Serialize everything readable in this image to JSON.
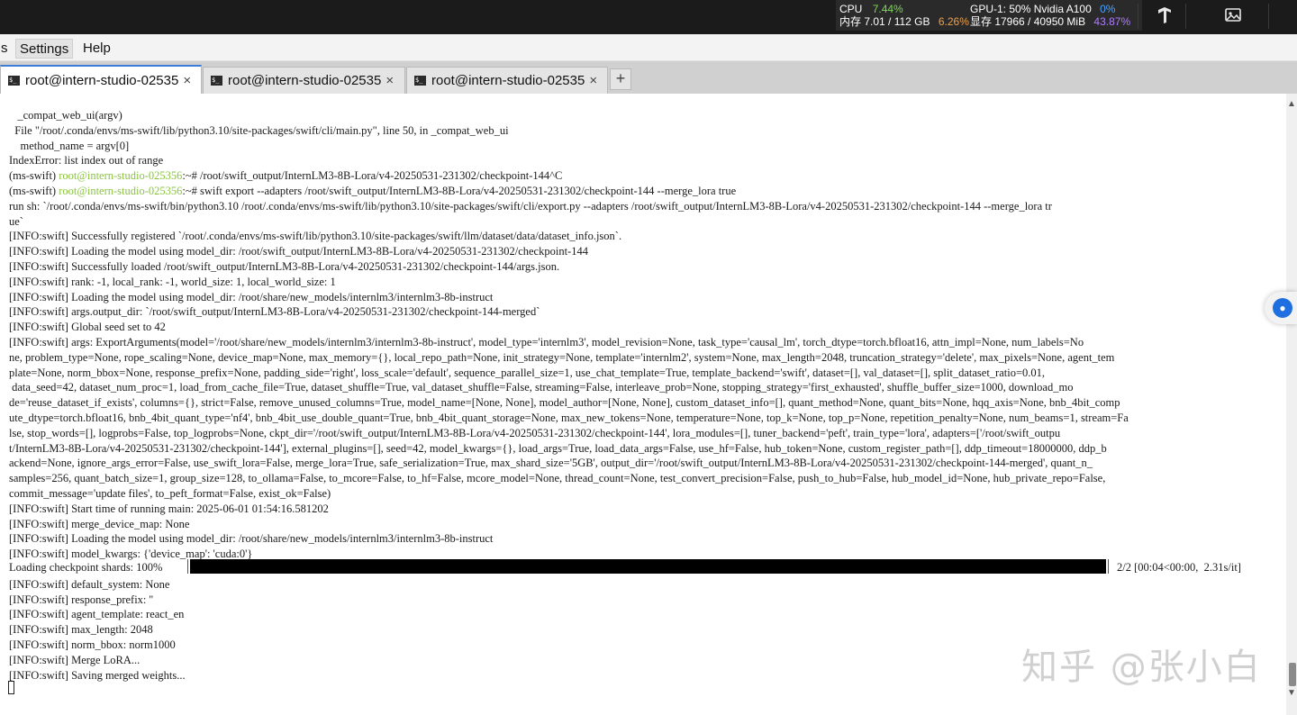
{
  "system_bar": {
    "cpu_label": "CPU",
    "cpu_value": "7.44%",
    "mem_label": "内存 7.01 / 112 GB",
    "mem_value": "6.26%",
    "gpu_label": "GPU-1: 50% Nvidia A100",
    "gpu_value": "0%",
    "vram_label": "显存 17966 / 40950 MiB",
    "vram_value": "43.87%",
    "icons": [
      "tensorflow-logo-icon",
      "image-icon"
    ]
  },
  "menu": {
    "items": [
      {
        "label": "s"
      },
      {
        "label": "Settings"
      },
      {
        "label": "Help"
      }
    ]
  },
  "tabs": [
    {
      "label": "root@intern-studio-02535",
      "close": "×"
    },
    {
      "label": "root@intern-studio-02535",
      "close": "×"
    },
    {
      "label": "root@intern-studio-02535",
      "close": "×"
    }
  ],
  "tab_add": "+",
  "terminal": {
    "lines": [
      "   _compat_web_ui(argv)",
      "  File \"/root/.conda/envs/ms-swift/lib/python3.10/site-packages/swift/cli/main.py\", line 50, in _compat_web_ui",
      "    method_name = argv[0]",
      "IndexError: list index out of range",
      "",
      "",
      "run sh: `/root/.conda/envs/ms-swift/bin/python3.10 /root/.conda/envs/ms-swift/lib/python3.10/site-packages/swift/cli/export.py --adapters /root/swift_output/InternLM3-8B-Lora/v4-20250531-231302/checkpoint-144 --merge_lora tr",
      "ue`",
      "[INFO:swift] Successfully registered `/root/.conda/envs/ms-swift/lib/python3.10/site-packages/swift/llm/dataset/data/dataset_info.json`.",
      "[INFO:swift] Loading the model using model_dir: /root/swift_output/InternLM3-8B-Lora/v4-20250531-231302/checkpoint-144",
      "[INFO:swift] Successfully loaded /root/swift_output/InternLM3-8B-Lora/v4-20250531-231302/checkpoint-144/args.json.",
      "[INFO:swift] rank: -1, local_rank: -1, world_size: 1, local_world_size: 1",
      "[INFO:swift] Loading the model using model_dir: /root/share/new_models/internlm3/internlm3-8b-instruct",
      "[INFO:swift] args.output_dir: `/root/swift_output/InternLM3-8B-Lora/v4-20250531-231302/checkpoint-144-merged`",
      "[INFO:swift] Global seed set to 42",
      "[INFO:swift] args: ExportArguments(model='/root/share/new_models/internlm3/internlm3-8b-instruct', model_type='internlm3', model_revision=None, task_type='causal_lm', torch_dtype=torch.bfloat16, attn_impl=None, num_labels=No",
      "ne, problem_type=None, rope_scaling=None, device_map=None, max_memory={}, local_repo_path=None, init_strategy=None, template='internlm2', system=None, max_length=2048, truncation_strategy='delete', max_pixels=None, agent_tem",
      "plate=None, norm_bbox=None, response_prefix=None, padding_side='right', loss_scale='default', sequence_parallel_size=1, use_chat_template=True, template_backend='swift', dataset=[], val_dataset=[], split_dataset_ratio=0.01,",
      " data_seed=42, dataset_num_proc=1, load_from_cache_file=True, dataset_shuffle=True, val_dataset_shuffle=False, streaming=False, interleave_prob=None, stopping_strategy='first_exhausted', shuffle_buffer_size=1000, download_mo",
      "de='reuse_dataset_if_exists', columns={}, strict=False, remove_unused_columns=True, model_name=[None, None], model_author=[None, None], custom_dataset_info=[], quant_method=None, quant_bits=None, hqq_axis=None, bnb_4bit_comp",
      "ute_dtype=torch.bfloat16, bnb_4bit_quant_type='nf4', bnb_4bit_use_double_quant=True, bnb_4bit_quant_storage=None, max_new_tokens=None, temperature=None, top_k=None, top_p=None, repetition_penalty=None, num_beams=1, stream=Fa",
      "lse, stop_words=[], logprobs=False, top_logprobs=None, ckpt_dir='/root/swift_output/InternLM3-8B-Lora/v4-20250531-231302/checkpoint-144', lora_modules=[], tuner_backend='peft', train_type='lora', adapters=['/root/swift_outpu",
      "t/InternLM3-8B-Lora/v4-20250531-231302/checkpoint-144'], external_plugins=[], seed=42, model_kwargs={}, load_args=True, load_data_args=False, use_hf=False, hub_token=None, custom_register_path=[], ddp_timeout=18000000, ddp_b",
      "ackend=None, ignore_args_error=False, use_swift_lora=False, merge_lora=True, safe_serialization=True, max_shard_size='5GB', output_dir='/root/swift_output/InternLM3-8B-Lora/v4-20250531-231302/checkpoint-144-merged', quant_n_",
      "samples=256, quant_batch_size=1, group_size=128, to_ollama=False, to_mcore=False, to_hf=False, mcore_model=None, thread_count=None, test_convert_precision=False, push_to_hub=False, hub_model_id=None, hub_private_repo=False,",
      "commit_message='update files', to_peft_format=False, exist_ok=False)",
      "[INFO:swift] Start time of running main: 2025-06-01 01:54:16.581202",
      "[INFO:swift] merge_device_map: None",
      "[INFO:swift] Loading the model using model_dir: /root/share/new_models/internlm3/internlm3-8b-instruct",
      "[INFO:swift] model_kwargs: {'device_map': 'cuda:0'}",
      "",
      "[INFO:swift] default_system: None",
      "[INFO:swift] response_prefix: ''",
      "[INFO:swift] agent_template: react_en",
      "[INFO:swift] max_length: 2048",
      "[INFO:swift] norm_bbox: norm1000",
      "[INFO:swift] Merge LoRA...",
      "[INFO:swift] Saving merged weights..."
    ],
    "prompt_lines": [
      {
        "env": "(ms-swift) ",
        "user": "root@intern-studio-025356",
        "rest": ":~# /root/swift_output/InternLM3-8B-Lora/v4-20250531-231302/checkpoint-144^C"
      },
      {
        "env": "(ms-swift) ",
        "user": "root@intern-studio-025356",
        "rest": ":~# swift export --adapters /root/swift_output/InternLM3-8B-Lora/v4-20250531-231302/checkpoint-144 --merge_lora true"
      }
    ],
    "progress": {
      "label": "Loading checkpoint shards: 100%",
      "fraction": 1.0,
      "suffix": "2/2 [00:04<00:00,  2.31s/it]"
    }
  },
  "watermark": "知乎 @张小白",
  "colors": {
    "prompt_user": "#8ac43f",
    "active_tab_accent": "#3c7bd6",
    "cpu_value": "#7ed957",
    "mem_value": "#f0a04b",
    "gpu_value": "#4aa3ff",
    "vram_value": "#b07cff"
  }
}
